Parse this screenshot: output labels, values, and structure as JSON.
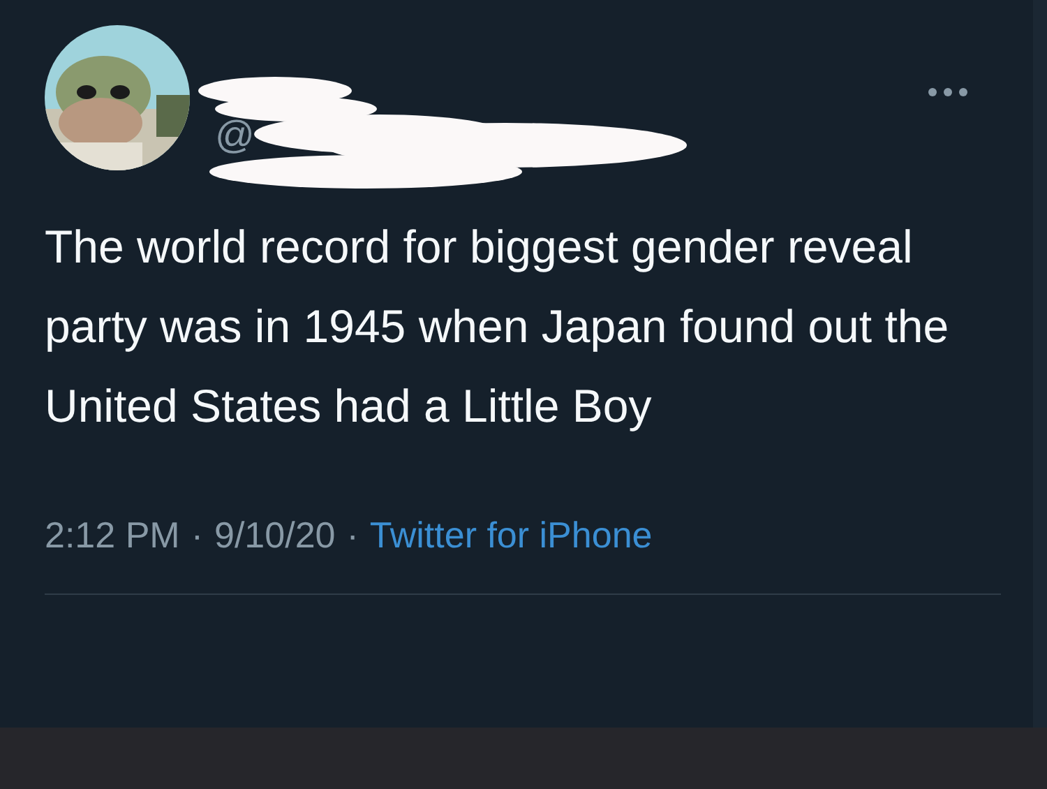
{
  "tweet": {
    "handle_prefix": "@",
    "text": "The world record for biggest gender reveal party was in 1945 when Japan found out the United States had a Little Boy",
    "time": "2:12 PM",
    "date": "9/10/20",
    "separator": "·",
    "source": "Twitter for iPhone"
  }
}
